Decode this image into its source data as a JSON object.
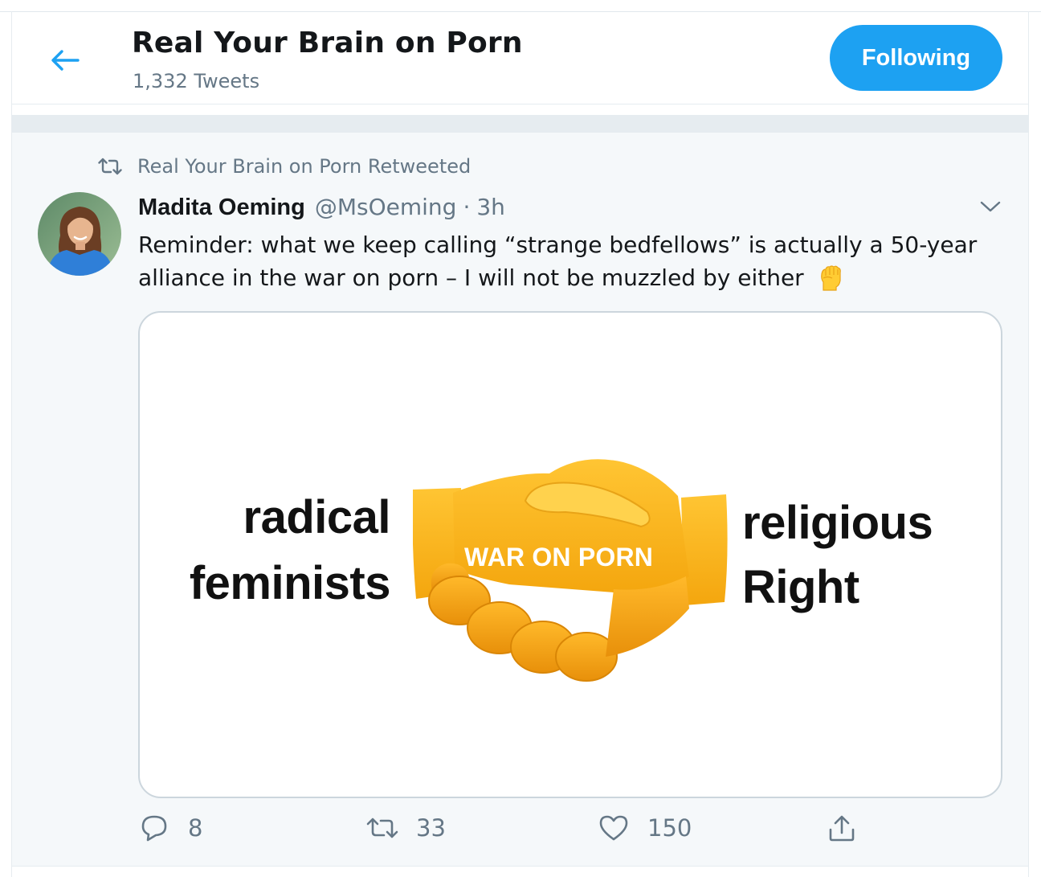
{
  "header": {
    "title": "Real Your Brain on Porn",
    "tweet_count": "1,332 Tweets",
    "follow_label": "Following"
  },
  "retweet": {
    "label": "Real Your Brain on Porn Retweeted"
  },
  "tweet": {
    "display_name": "Madita Oeming",
    "handle": "@MsOeming",
    "separator": "·",
    "time": "3h",
    "text": "Reminder: what we keep calling “strange bedfellows” is actually a 50-year alliance in the war on porn – I will not be muzzled by either"
  },
  "media": {
    "left_line1": "radical",
    "left_line2": "feminists",
    "right_line1": "religious",
    "right_line2": "Right",
    "center_label": "WAR ON PORN"
  },
  "actions": {
    "replies": "8",
    "retweets": "33",
    "likes": "150"
  },
  "icons": {
    "back": "back-arrow-icon",
    "retweet": "retweet-icon",
    "caret": "chevron-down-icon",
    "reply": "reply-icon",
    "like": "heart-icon",
    "share": "share-icon",
    "emoji": "raised-fist-emoji"
  },
  "colors": {
    "accent": "#1da1f2",
    "muted_text": "#657786",
    "background_tweet": "#f5f8fa",
    "border": "#e6ecf0"
  }
}
